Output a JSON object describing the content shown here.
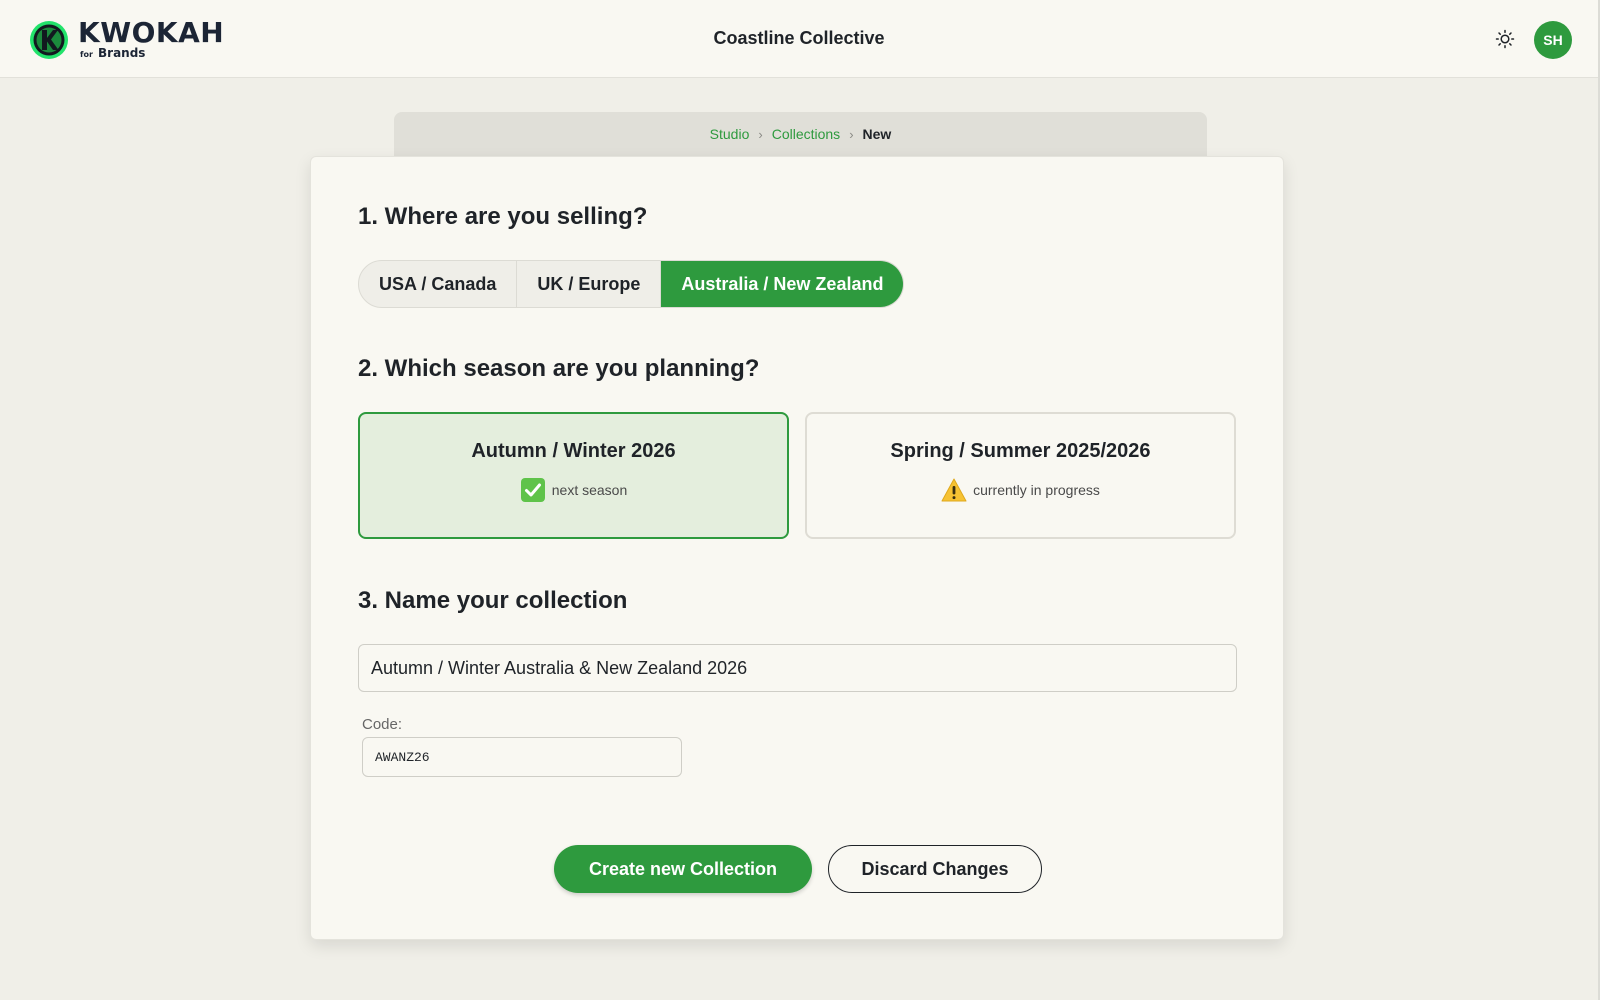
{
  "header": {
    "logo": {
      "word": "KWOKAH",
      "sub_for": "for",
      "sub_brands": "Brands"
    },
    "org_name": "Coastline Collective",
    "theme_toggle_icon": "sun-icon",
    "avatar_initials": "SH"
  },
  "breadcrumb": {
    "items": [
      "Studio",
      "Collections"
    ],
    "current": "New",
    "separator": "›"
  },
  "form": {
    "region": {
      "title": "1. Where are you selling?",
      "options": [
        "USA / Canada",
        "UK / Europe",
        "Australia / New Zealand"
      ],
      "selected": "Australia / New Zealand"
    },
    "season": {
      "title": "2. Which season are you planning?",
      "options": [
        {
          "title": "Autumn / Winter 2026",
          "status": "next season",
          "status_icon": "check-mark-icon",
          "selected": true
        },
        {
          "title": "Spring / Summer 2025/2026",
          "status": "currently in progress",
          "status_icon": "warning-icon",
          "selected": false
        }
      ]
    },
    "name": {
      "title": "3. Name your collection",
      "value": "Autumn / Winter Australia & New Zealand 2026",
      "code_label": "Code:",
      "code_value": "AWANZ26"
    }
  },
  "actions": {
    "create_label": "Create new Collection",
    "discard_label": "Discard Changes"
  },
  "colors": {
    "accent": "#2e9a3e",
    "page_background": "#f0efe8",
    "surface": "#f9f8f2",
    "selected_card": "#e4eedd",
    "text": "#1f2328"
  }
}
